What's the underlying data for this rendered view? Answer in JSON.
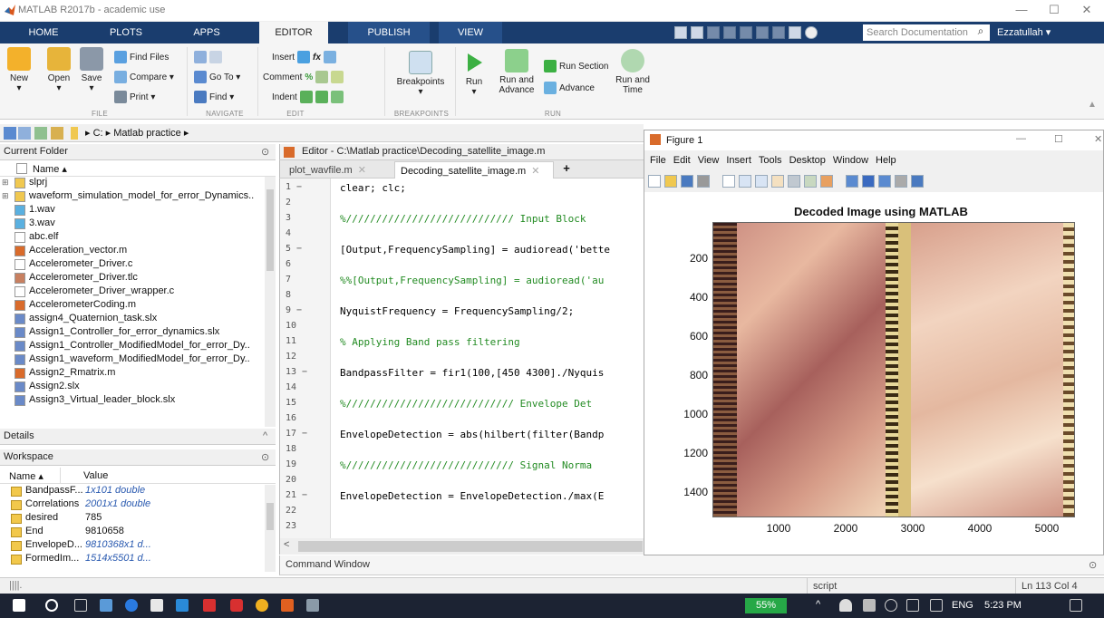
{
  "window": {
    "title": "MATLAB R2017b - academic use",
    "min": "—",
    "max": "☐",
    "close": "✕"
  },
  "tabs": [
    "HOME",
    "PLOTS",
    "APPS",
    "EDITOR",
    "PUBLISH",
    "VIEW"
  ],
  "search_placeholder": "Search Documentation",
  "user": "Ezzatullah ▾",
  "ribbon": {
    "file": {
      "new": "New",
      "open": "Open",
      "save": "Save",
      "find_files": "Find Files",
      "compare": "Compare ▾",
      "print": "Print ▾",
      "group": "FILE"
    },
    "navigate": {
      "goto": "Go To ▾",
      "find": "Find ▾",
      "group": "NAVIGATE"
    },
    "edit": {
      "insert": "Insert",
      "comment": "Comment",
      "indent": "Indent",
      "group": "EDIT"
    },
    "breakpoints": {
      "label": "Breakpoints",
      "group": "BREAKPOINTS"
    },
    "run": {
      "run": "Run",
      "run_advance": "Run and Advance",
      "run_section": "Run Section",
      "advance": "Advance",
      "run_time": "Run and Time",
      "group": "RUN"
    }
  },
  "path": "▸ C: ▸ Matlab practice ▸",
  "current_folder": {
    "title": "Current Folder",
    "name_header": "Name ▴",
    "items": [
      "slprj",
      "waveform_simulation_model_for_error_Dynamics..",
      "1.wav",
      "3.wav",
      "abc.elf",
      "Acceleration_vector.m",
      "Accelerometer_Driver.c",
      "Accelerometer_Driver.tlc",
      "Accelerometer_Driver_wrapper.c",
      "AccelerometerCoding.m",
      "assign4_Quaternion_task.slx",
      "Assign1_Controller_for_error_dynamics.slx",
      "Assign1_Controller_ModifiedModel_for_error_Dy..",
      "Assign1_waveform_ModifiedModel_for_error_Dy..",
      "Assign2_Rmatrix.m",
      "Assign2.slx",
      "Assign3_Virtual_leader_block.slx"
    ]
  },
  "details": "Details",
  "workspace": {
    "title": "Workspace",
    "col_name": "Name ▴",
    "col_value": "Value",
    "rows": [
      {
        "name": "BandpassF...",
        "value": "1x101 double",
        "italic": true
      },
      {
        "name": "Correlations",
        "value": "2001x1 double",
        "italic": true
      },
      {
        "name": "desired",
        "value": "785",
        "italic": false
      },
      {
        "name": "End",
        "value": "9810658",
        "italic": false
      },
      {
        "name": "EnvelopeD...",
        "value": "9810368x1 d...",
        "italic": true
      },
      {
        "name": "FormedIm...",
        "value": "1514x5501 d...",
        "italic": true
      }
    ]
  },
  "editor": {
    "title": "Editor - C:\\Matlab practice\\Decoding_satellite_image.m",
    "tabs": [
      "plot_wavfile.m",
      "Decoding_satellite_image.m"
    ],
    "tab_add": "+",
    "lines": [
      {
        "n": "1 −",
        "code": "clear; clc;",
        "color": "#000"
      },
      {
        "n": "2",
        "code": "",
        "color": "#000"
      },
      {
        "n": "3",
        "code": "%////////////////////////////   Input Block",
        "color": "#228b22"
      },
      {
        "n": "4",
        "code": "",
        "color": "#000"
      },
      {
        "n": "5 −",
        "code": "[Output,FrequencySampling] = audioread('bette",
        "color": "#000"
      },
      {
        "n": "6",
        "code": "",
        "color": "#000"
      },
      {
        "n": "7",
        "code": "%%[Output,FrequencySampling] = audioread('au",
        "color": "#228b22"
      },
      {
        "n": "8",
        "code": "",
        "color": "#000"
      },
      {
        "n": "9 −",
        "code": "NyquistFrequency = FrequencySampling/2;",
        "color": "#000"
      },
      {
        "n": "10",
        "code": "",
        "color": "#000"
      },
      {
        "n": "11",
        "code": "% Applying Band pass filtering",
        "color": "#228b22"
      },
      {
        "n": "12",
        "code": "",
        "color": "#000"
      },
      {
        "n": "13 −",
        "code": "BandpassFilter = fir1(100,[450 4300]./Nyquis",
        "color": "#000"
      },
      {
        "n": "14",
        "code": "",
        "color": "#000"
      },
      {
        "n": "15",
        "code": "%////////////////////////////   Envelope Det",
        "color": "#228b22"
      },
      {
        "n": "16",
        "code": "",
        "color": "#000"
      },
      {
        "n": "17 −",
        "code": "EnvelopeDetection = abs(hilbert(filter(Bandp",
        "color": "#000"
      },
      {
        "n": "18",
        "code": "",
        "color": "#000"
      },
      {
        "n": "19",
        "code": "%////////////////////////////   Signal Norma",
        "color": "#228b22"
      },
      {
        "n": "20",
        "code": "",
        "color": "#000"
      },
      {
        "n": "21 −",
        "code": "EnvelopeDetection = EnvelopeDetection./max(E",
        "color": "#000"
      },
      {
        "n": "22",
        "code": "",
        "color": "#000"
      },
      {
        "n": "23",
        "code": "",
        "color": "#000"
      }
    ]
  },
  "command_window": "Command Window",
  "figure": {
    "title": "Figure 1",
    "menu": [
      "File",
      "Edit",
      "View",
      "Insert",
      "Tools",
      "Desktop",
      "Window",
      "Help"
    ],
    "plot_title": "Decoded Image using MATLAB",
    "yticks": [
      "200",
      "400",
      "600",
      "800",
      "1000",
      "1200",
      "1400"
    ],
    "xticks": [
      "1000",
      "2000",
      "3000",
      "4000",
      "5000"
    ]
  },
  "status": {
    "script": "script",
    "position": "Ln 113   Col 4"
  },
  "taskbar": {
    "battery": "55%",
    "lang": "ENG",
    "time": "5:23 PM"
  }
}
